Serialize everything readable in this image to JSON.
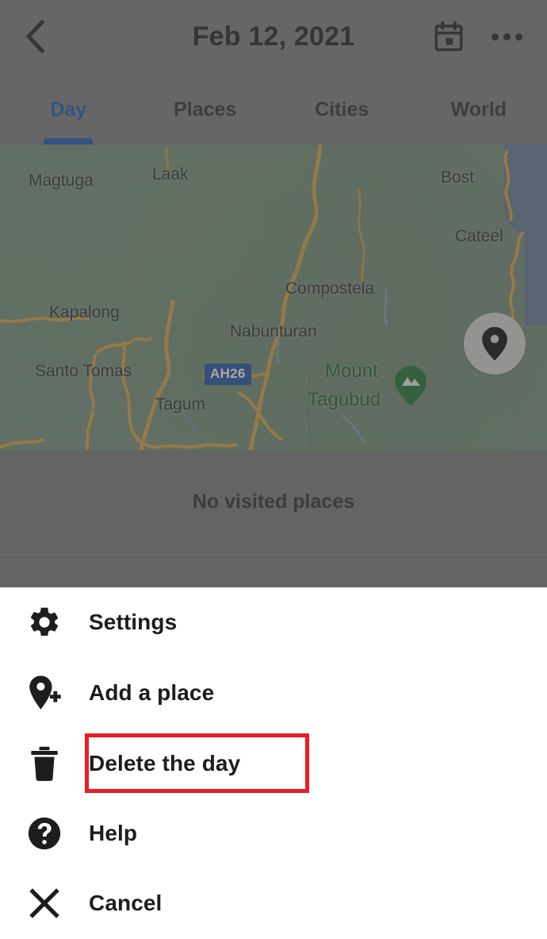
{
  "header": {
    "title": "Feb 12, 2021",
    "back_icon": "chevron-left-icon",
    "calendar_icon": "calendar-icon",
    "overflow_icon": "more-options-icon"
  },
  "tabs": [
    {
      "label": "Day",
      "active": true
    },
    {
      "label": "Places",
      "active": false
    },
    {
      "label": "Cities",
      "active": false
    },
    {
      "label": "World",
      "active": false
    }
  ],
  "map": {
    "my_location_icon": "map-pin-icon",
    "highway_shield": "AH26",
    "labels": [
      "Magtuga",
      "Laak",
      "Bost",
      "Cateel",
      "Compostela",
      "Kapalong",
      "Nabunturan",
      "Santo Tomas",
      "Tagum"
    ],
    "park_label_line1": "Mount",
    "park_label_line2": "Tagubud",
    "park_icon": "mountain-park-pin-icon"
  },
  "list": {
    "empty_text": "No visited places"
  },
  "sheet": {
    "items": [
      {
        "label": "Settings",
        "icon": "gear-icon",
        "highlighted": false
      },
      {
        "label": "Add a place",
        "icon": "add-place-pin-icon",
        "highlighted": false
      },
      {
        "label": "Delete the day",
        "icon": "trash-icon",
        "highlighted": true
      },
      {
        "label": "Help",
        "icon": "help-circle-icon",
        "highlighted": false
      },
      {
        "label": "Cancel",
        "icon": "close-x-icon",
        "highlighted": false
      }
    ]
  },
  "colors": {
    "accent_blue": "#2f63b5",
    "highlight_red": "#ec1c24",
    "scrim_gray": "#828282",
    "map_green": "#7d9480",
    "map_water": "#6c8299",
    "park_green": "#2e6b35",
    "road_orange": "#d9a84e"
  }
}
